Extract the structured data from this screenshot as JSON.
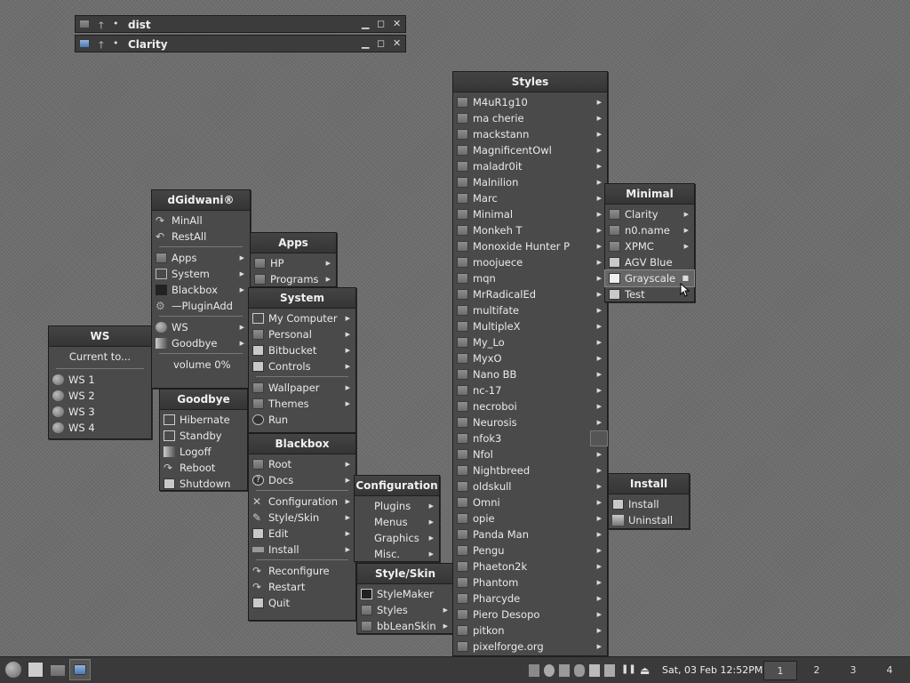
{
  "windows": [
    {
      "title": "dist"
    },
    {
      "title": "Clarity"
    }
  ],
  "menus": {
    "dgidwani": {
      "title": "dGidwani®",
      "items": [
        "MinAll",
        "RestAll",
        "Apps",
        "System",
        "Blackbox",
        "—PluginAdd",
        "WS",
        "Goodbye",
        "volume 0%"
      ]
    },
    "ws": {
      "title": "WS",
      "current": "Current to...",
      "items": [
        "WS 1",
        "WS 2",
        "WS 3",
        "WS 4"
      ]
    },
    "goodbye": {
      "title": "Goodbye",
      "items": [
        "Hibernate",
        "Standby",
        "Logoff",
        "Reboot",
        "Shutdown"
      ]
    },
    "apps": {
      "title": "Apps",
      "items": [
        "HP",
        "Programs"
      ]
    },
    "system": {
      "title": "System",
      "items": [
        "My Computer",
        "Personal",
        "Bitbucket",
        "Controls",
        "Wallpaper",
        "Themes",
        "Run"
      ]
    },
    "blackbox": {
      "title": "Blackbox",
      "items": [
        "Root",
        "Docs",
        "Configuration",
        "Style/Skin",
        "Edit",
        "Install",
        "Reconfigure",
        "Restart",
        "Quit"
      ]
    },
    "configuration": {
      "title": "Configuration",
      "items": [
        "Plugins",
        "Menus",
        "Graphics",
        "Misc."
      ]
    },
    "styleskin": {
      "title": "Style/Skin",
      "items": [
        "StyleMaker",
        "Styles",
        "bbLeanSkin"
      ]
    },
    "styles": {
      "title": "Styles",
      "items": [
        "M4uR1g10",
        "ma cherie",
        "mackstann",
        "MagnificentOwl",
        "maladr0it",
        "Malnilion",
        "Marc",
        "Minimal",
        "Monkeh T",
        "Monoxide Hunter P",
        "moojuece",
        "mqn",
        "MrRadicalEd",
        "multifate",
        "MultipleX",
        "My_Lo",
        "MyxO",
        "Nano BB",
        "nc-17",
        "necroboi",
        "Neurosis",
        "nfok3",
        "Nfol",
        "Nightbreed",
        "oldskull",
        "Omni",
        "opie",
        "Panda Man",
        "Pengu",
        "Phaeton2k",
        "Phantom",
        "Pharcyde",
        "Piero Desopo",
        "pitkon",
        "pixelforge.org"
      ]
    },
    "minimal": {
      "title": "Minimal",
      "items": [
        "Clarity",
        "n0.name",
        "XPMC",
        "AGV Blue",
        "Grayscale",
        "Test"
      ]
    },
    "install": {
      "title": "Install",
      "items": [
        "Install",
        "Uninstall"
      ]
    }
  },
  "taskbar": {
    "clock": "Sat, 03 Feb 12:52PM",
    "workspaces": [
      "1",
      "2",
      "3",
      "4"
    ],
    "active_workspace": "1"
  }
}
